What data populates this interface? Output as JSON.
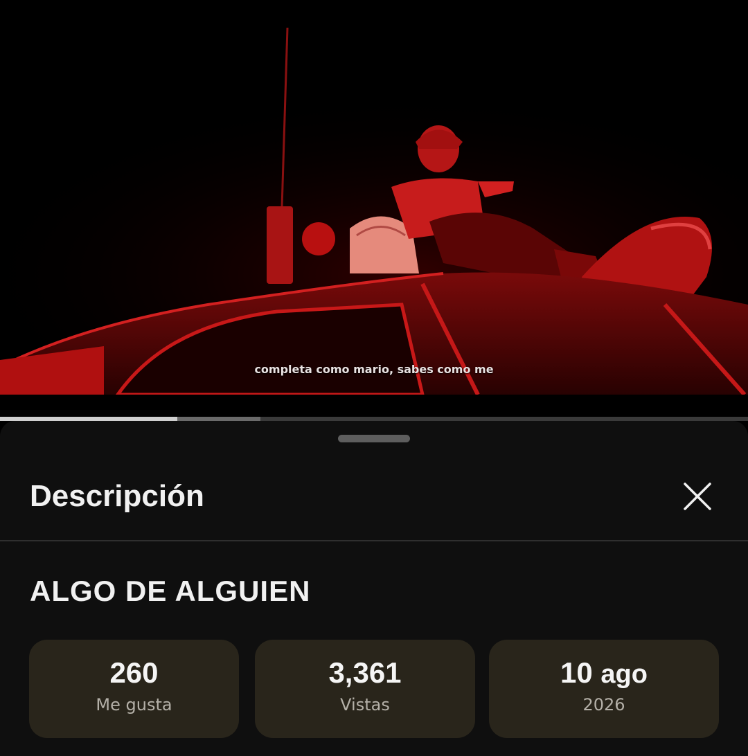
{
  "video": {
    "subtitle": "completa como mario, sabes como me",
    "progress": {
      "played_fraction": 0.237,
      "buffered_fraction": 0.348
    }
  },
  "sheet": {
    "title": "Descripción",
    "close_icon": "close-icon",
    "video_title": "ALGO DE ALGUIEN",
    "stats": {
      "likes": {
        "value": "260",
        "label": "Me gusta"
      },
      "views": {
        "value": "3,361",
        "label": "Vistas"
      },
      "date": {
        "value_day": "10",
        "value_month": "ago",
        "label": "2026"
      }
    }
  },
  "colors": {
    "sheet_background": "#0f0f0f",
    "stat_background": "#29251b",
    "scene_red": "#d81818"
  }
}
